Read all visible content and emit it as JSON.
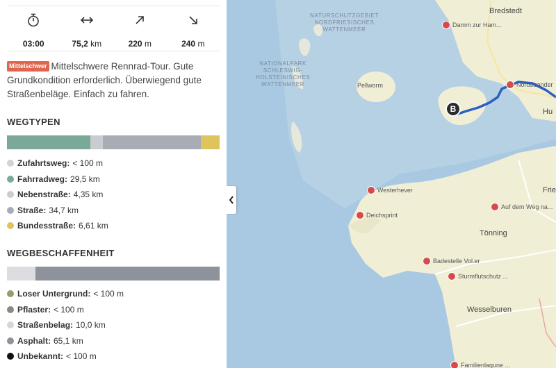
{
  "stats": [
    {
      "icon": "stopwatch-icon",
      "value": "03:00",
      "unit": ""
    },
    {
      "icon": "distance-arrows-icon",
      "value": "75,2",
      "unit": "km"
    },
    {
      "icon": "ascent-arrow-icon",
      "value": "220",
      "unit": "m"
    },
    {
      "icon": "descent-arrow-icon",
      "value": "240",
      "unit": "m"
    }
  ],
  "description": {
    "badge": "Mittelschwer",
    "text": "Mittelschwere Rennrad-Tour. Gute Grundkondition erforderlich. Überwiegend gute Straßenbeläge. Einfach zu fahren.",
    "badge_color": "#e0654f"
  },
  "wegtypen": {
    "title": "WEGTYPEN",
    "bar": [
      {
        "color": "#cfd2d6",
        "share": 0.0013
      },
      {
        "color": "#7aa99a",
        "share": 0.392
      },
      {
        "color": "#c9ccd1",
        "share": 0.058
      },
      {
        "color": "#a8acb4",
        "share": 0.461
      },
      {
        "color": "#dfc45e",
        "share": 0.088
      }
    ],
    "items": [
      {
        "label": "Zufahrtsweg:",
        "value": "< 100 m",
        "color": "#cfd2d6"
      },
      {
        "label": "Fahrradweg:",
        "value": "29,5 km",
        "color": "#7aa99a"
      },
      {
        "label": "Nebenstraße:",
        "value": "4,35 km",
        "color": "#c9ccd1"
      },
      {
        "label": "Straße:",
        "value": "34,7 km",
        "color": "#a8acb4"
      },
      {
        "label": "Bundesstraße:",
        "value": "6,61 km",
        "color": "#dfc45e"
      }
    ]
  },
  "wegbeschaffenheit": {
    "title": "WEGBESCHAFFENHEIT",
    "bar": [
      {
        "color": "#dcdde0",
        "share": 0.133
      },
      {
        "color": "#8e939b",
        "share": 0.867
      }
    ],
    "items": [
      {
        "label": "Loser Untergrund:",
        "value": "< 100 m",
        "color": "#9a9a6e"
      },
      {
        "label": "Pflaster:",
        "value": "< 100 m",
        "color": "#8a8a80"
      },
      {
        "label": "Straßenbelag:",
        "value": "10,0 km",
        "color": "#d4d6d9"
      },
      {
        "label": "Asphalt:",
        "value": "65,1 km",
        "color": "#8e939b"
      },
      {
        "label": "Unbekannt:",
        "value": "< 100 m",
        "color": "#111111"
      }
    ]
  },
  "map": {
    "park_label_1": "NATURSCHUTZGEBIET\nNORDFRIESISCHES\nWATTENMEER",
    "park_label_2": "NATIONALPARK\nSCHLESWIG-\nHOLSTEINISCHES\nWATTENMEER",
    "places": {
      "bredstedt": "Bredstedt",
      "pellworm": "Pellworm",
      "westerhever": "Westerhever",
      "tonning": "Tönning",
      "wesselburen": "Wesselburen",
      "friedr": "Fried",
      "hu": "Hu"
    },
    "pois": {
      "damm": "Damm zur Ham...",
      "nordstrander": "Nordstrander",
      "westerhever_poi": "Westerhever",
      "deichsprint": "Deichsprint",
      "aufdemweg": "Auf dem Weg na...",
      "badestelle": "Badestelle Vol.er",
      "sturmflut": "Sturmflutschutz ...",
      "familienlagune": "Familienlagune ..."
    },
    "marker": "B",
    "route_color": "#2a5fc4",
    "water_color": "#a8c8e0",
    "land_color": "#f2eed6"
  }
}
